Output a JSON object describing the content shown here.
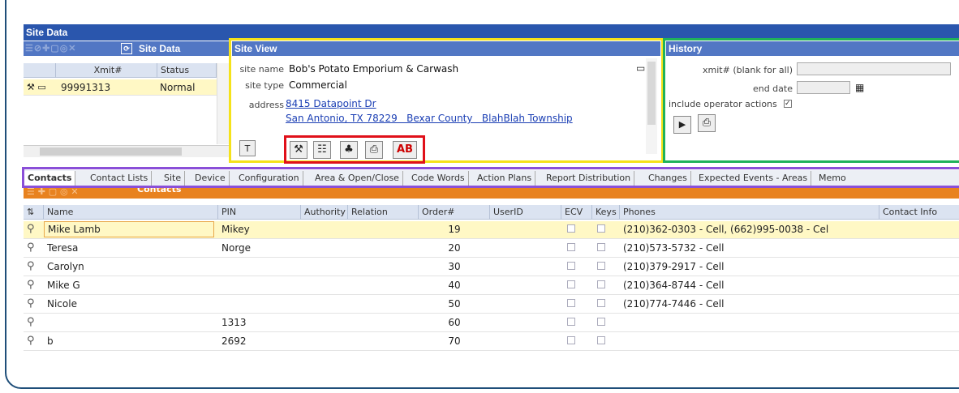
{
  "app_title": "Site Data",
  "site_list": {
    "panel_title": "Site Data",
    "columns": [
      "Xmit#",
      "Status"
    ],
    "rows": [
      {
        "xmit": "99991313",
        "status": "Normal"
      }
    ]
  },
  "site_view": {
    "title": "Site View",
    "site_name_label": "site name",
    "site_name": "Bob's Potato Emporium & Carwash",
    "site_type_label": "site type",
    "site_type": "Commercial",
    "address_label": "address",
    "address_line1": "8415 Datapoint Dr",
    "address_line2": "San Antonio, TX 78229   Bexar County   BlahBlah Township",
    "ab_label": "AB"
  },
  "history": {
    "title": "History",
    "xmit_label": "xmit# (blank for all)",
    "end_date_label": "end date",
    "include_label": "include operator actions"
  },
  "tabs": [
    "Contacts",
    "Contact Lists",
    "Site",
    "Device",
    "Configuration",
    "Area & Open/Close",
    "Code Words",
    "Action Plans",
    "Report Distribution",
    "Changes",
    "Expected Events - Areas",
    "Memo"
  ],
  "contacts": {
    "panel_title": "Contacts",
    "columns": {
      "name": "Name",
      "pin": "PIN",
      "authority": "Authority",
      "relation": "Relation",
      "order": "Order#",
      "userid": "UserID",
      "ecv": "ECV",
      "keys": "Keys",
      "phones": "Phones",
      "info": "Contact Info"
    },
    "rows": [
      {
        "name": "Mike Lamb",
        "pin": "Mikey",
        "order": "19",
        "phones": "(210)362-0303 - Cell, (662)995-0038 - Cel"
      },
      {
        "name": "Teresa",
        "pin": "Norge",
        "order": "20",
        "phones": "(210)573-5732 - Cell"
      },
      {
        "name": "Carolyn",
        "pin": "",
        "order": "30",
        "phones": "(210)379-2917 - Cell"
      },
      {
        "name": "Mike G",
        "pin": "",
        "order": "40",
        "phones": "(210)364-8744 - Cell"
      },
      {
        "name": "Nicole",
        "pin": "",
        "order": "50",
        "phones": "(210)774-7446 - Cell"
      },
      {
        "name": "",
        "pin": "1313",
        "order": "60",
        "phones": ""
      },
      {
        "name": "b",
        "pin": "2692",
        "order": "70",
        "phones": ""
      }
    ]
  },
  "colors": {
    "title_bar": "#2a56ad",
    "sub_bar": "#5277c4",
    "selected_row": "#fff8c5",
    "contacts_bar": "#e8821f",
    "outline_yellow": "#f5e21a",
    "outline_green": "#1fb25a",
    "outline_red": "#e0101a",
    "outline_purple": "#8a4fd8",
    "frame": "#1f4e79"
  }
}
